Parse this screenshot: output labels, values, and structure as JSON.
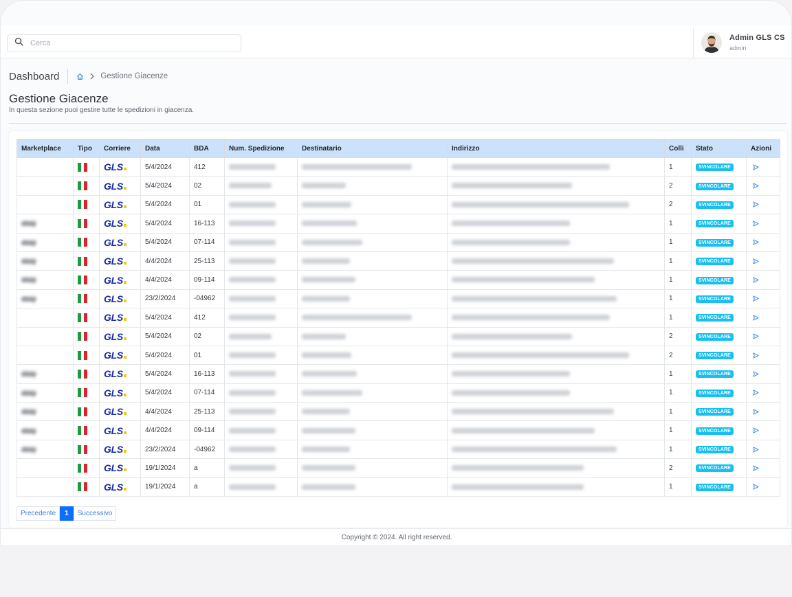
{
  "search": {
    "placeholder": "Cerca"
  },
  "user": {
    "name": "Admin GLS CS",
    "role": "admin"
  },
  "breadcrumb": {
    "root": "Dashboard",
    "current": "Gestione Giacenze"
  },
  "page": {
    "title": "Gestione Giacenze",
    "subtitle": "In questa sezione puoi gestire tutte le spedizioni in giacenza."
  },
  "table": {
    "columns": [
      "Marketplace",
      "Tipo",
      "Corriere",
      "Data",
      "BDA",
      "Num. Spedizione",
      "Destinatario",
      "Indirizzo",
      "Colli",
      "Stato",
      "Azioni"
    ],
    "rows": [
      {
        "marketplace": "",
        "data": "5/4/2024",
        "bda": "412",
        "colli": "1",
        "stato": "SVINCOLARE"
      },
      {
        "marketplace": "",
        "data": "5/4/2024",
        "bda": "02",
        "colli": "2",
        "stato": "SVINCOLARE"
      },
      {
        "marketplace": "",
        "data": "5/4/2024",
        "bda": "01",
        "colli": "2",
        "stato": "SVINCOLARE"
      },
      {
        "marketplace": "ebay",
        "data": "5/4/2024",
        "bda": "16-113",
        "colli": "1",
        "stato": "SVINCOLARE"
      },
      {
        "marketplace": "ebay",
        "data": "5/4/2024",
        "bda": "07-114",
        "colli": "1",
        "stato": "SVINCOLARE"
      },
      {
        "marketplace": "ebay",
        "data": "4/4/2024",
        "bda": "25-113",
        "colli": "1",
        "stato": "SVINCOLARE"
      },
      {
        "marketplace": "ebay",
        "data": "4/4/2024",
        "bda": "09-114",
        "colli": "1",
        "stato": "SVINCOLARE"
      },
      {
        "marketplace": "ebay",
        "data": "23/2/2024",
        "bda": "-04962",
        "colli": "1",
        "stato": "SVINCOLARE"
      },
      {
        "marketplace": "",
        "data": "5/4/2024",
        "bda": "412",
        "colli": "1",
        "stato": "SVINCOLARE"
      },
      {
        "marketplace": "",
        "data": "5/4/2024",
        "bda": "02",
        "colli": "2",
        "stato": "SVINCOLARE"
      },
      {
        "marketplace": "",
        "data": "5/4/2024",
        "bda": "01",
        "colli": "2",
        "stato": "SVINCOLARE"
      },
      {
        "marketplace": "ebay",
        "data": "5/4/2024",
        "bda": "16-113",
        "colli": "1",
        "stato": "SVINCOLARE"
      },
      {
        "marketplace": "ebay",
        "data": "5/4/2024",
        "bda": "07-114",
        "colli": "1",
        "stato": "SVINCOLARE"
      },
      {
        "marketplace": "ebay",
        "data": "4/4/2024",
        "bda": "25-113",
        "colli": "1",
        "stato": "SVINCOLARE"
      },
      {
        "marketplace": "ebay",
        "data": "4/4/2024",
        "bda": "09-114",
        "colli": "1",
        "stato": "SVINCOLARE"
      },
      {
        "marketplace": "ebay",
        "data": "23/2/2024",
        "bda": "-04962",
        "colli": "1",
        "stato": "SVINCOLARE"
      },
      {
        "marketplace": "",
        "data": "19/1/2024",
        "bda": "a",
        "colli": "2",
        "stato": "SVINCOLARE"
      },
      {
        "marketplace": "",
        "data": "19/1/2024",
        "bda": "a",
        "colli": "1",
        "stato": "SVINCOLARE"
      }
    ]
  },
  "carrier_logo": "GLS",
  "tipo_icon": "italy-flag-icon",
  "pagination": {
    "prev": "Precedente",
    "page": "1",
    "next": "Successivo"
  },
  "footer": {
    "copyright": "Copyright © 2024. All right reserved."
  },
  "colors": {
    "accent": "#0d6efd",
    "badge": "#18bff0",
    "header_row": "#cce2fb",
    "gls_blue": "#1729a6",
    "gls_yellow": "#f7c600"
  }
}
